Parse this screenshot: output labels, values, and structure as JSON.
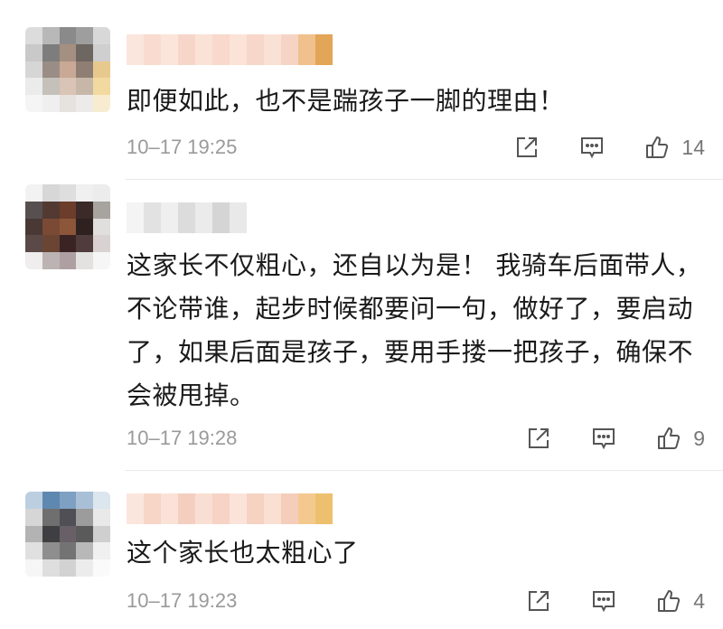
{
  "comments": [
    {
      "text": "即便如此，也不是踹孩子一脚的理由！",
      "time": "10–17 19:25",
      "likes": "14"
    },
    {
      "text": "这家长不仅粗心，还自以为是！ 我骑车后面带人，不论带谁，起步时候都要问一句，做好了，要启动了，如果后面是孩子，要用手搂一把孩子，确保不会被甩掉。",
      "time": "10–17 19:28",
      "likes": "9"
    },
    {
      "text": "这个家长也太粗心了",
      "time": "10–17 19:23",
      "likes": "4"
    }
  ],
  "icons": {
    "share": "share-icon",
    "reply": "comment-icon",
    "like": "thumbs-up-icon"
  },
  "colors": {
    "text": "#1a1a1a",
    "meta": "#9a9a9a",
    "icon": "#555555"
  }
}
